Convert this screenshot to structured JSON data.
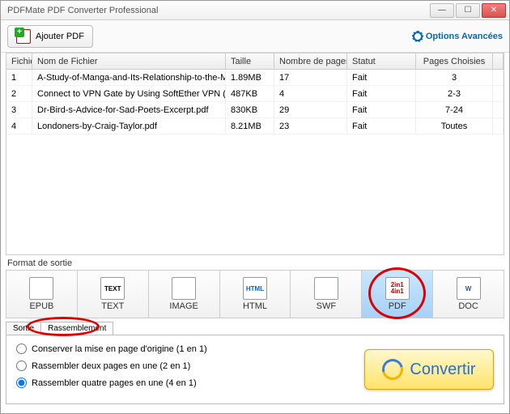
{
  "window": {
    "title": "PDFMate PDF Converter Professional"
  },
  "toolbar": {
    "add_label": "Ajouter PDF",
    "options_label": "Options Avancées"
  },
  "table": {
    "headers": {
      "idx": "Fichier",
      "name": "Nom de Fichier",
      "size": "Taille",
      "pages": "Nombre de pages",
      "status": "Statut",
      "chosen": "Pages Choisies"
    },
    "rows": [
      {
        "idx": "1",
        "name": "A-Study-of-Manga-and-Its-Relationship-to-the-Modern-Japan...",
        "size": "1.89MB",
        "pages": "17",
        "status": "Fait",
        "chosen": "3"
      },
      {
        "idx": "2",
        "name": "Connect to VPN Gate by Using SoftEther VPN (SSL-VPN).pdf",
        "size": "487KB",
        "pages": "4",
        "status": "Fait",
        "chosen": "2-3"
      },
      {
        "idx": "3",
        "name": "Dr-Bird-s-Advice-for-Sad-Poets-Excerpt.pdf",
        "size": "830KB",
        "pages": "29",
        "status": "Fait",
        "chosen": "7-24"
      },
      {
        "idx": "4",
        "name": "Londoners-by-Craig-Taylor.pdf",
        "size": "8.21MB",
        "pages": "23",
        "status": "Fait",
        "chosen": "Toutes"
      }
    ]
  },
  "output_format": {
    "section_label": "Format de sortie",
    "selected": "PDF",
    "items": [
      {
        "key": "EPUB",
        "label": "EPUB"
      },
      {
        "key": "TEXT",
        "label": "TEXT"
      },
      {
        "key": "IMAGE",
        "label": "IMAGE"
      },
      {
        "key": "HTML",
        "label": "HTML"
      },
      {
        "key": "SWF",
        "label": "SWF"
      },
      {
        "key": "PDF",
        "label": "PDF"
      },
      {
        "key": "DOC",
        "label": "DOC"
      }
    ]
  },
  "sortie": {
    "tab_prefix": "Sortie",
    "tab_selected": "Rassemblement",
    "radios": [
      {
        "label": "Conserver la mise en page d'origine (1 en 1)",
        "checked": false
      },
      {
        "label": "Rassembler deux pages en une (2 en 1)",
        "checked": false
      },
      {
        "label": "Rassembler quatre pages en une (4 en 1)",
        "checked": true
      }
    ]
  },
  "convert": {
    "label": "Convertir"
  }
}
